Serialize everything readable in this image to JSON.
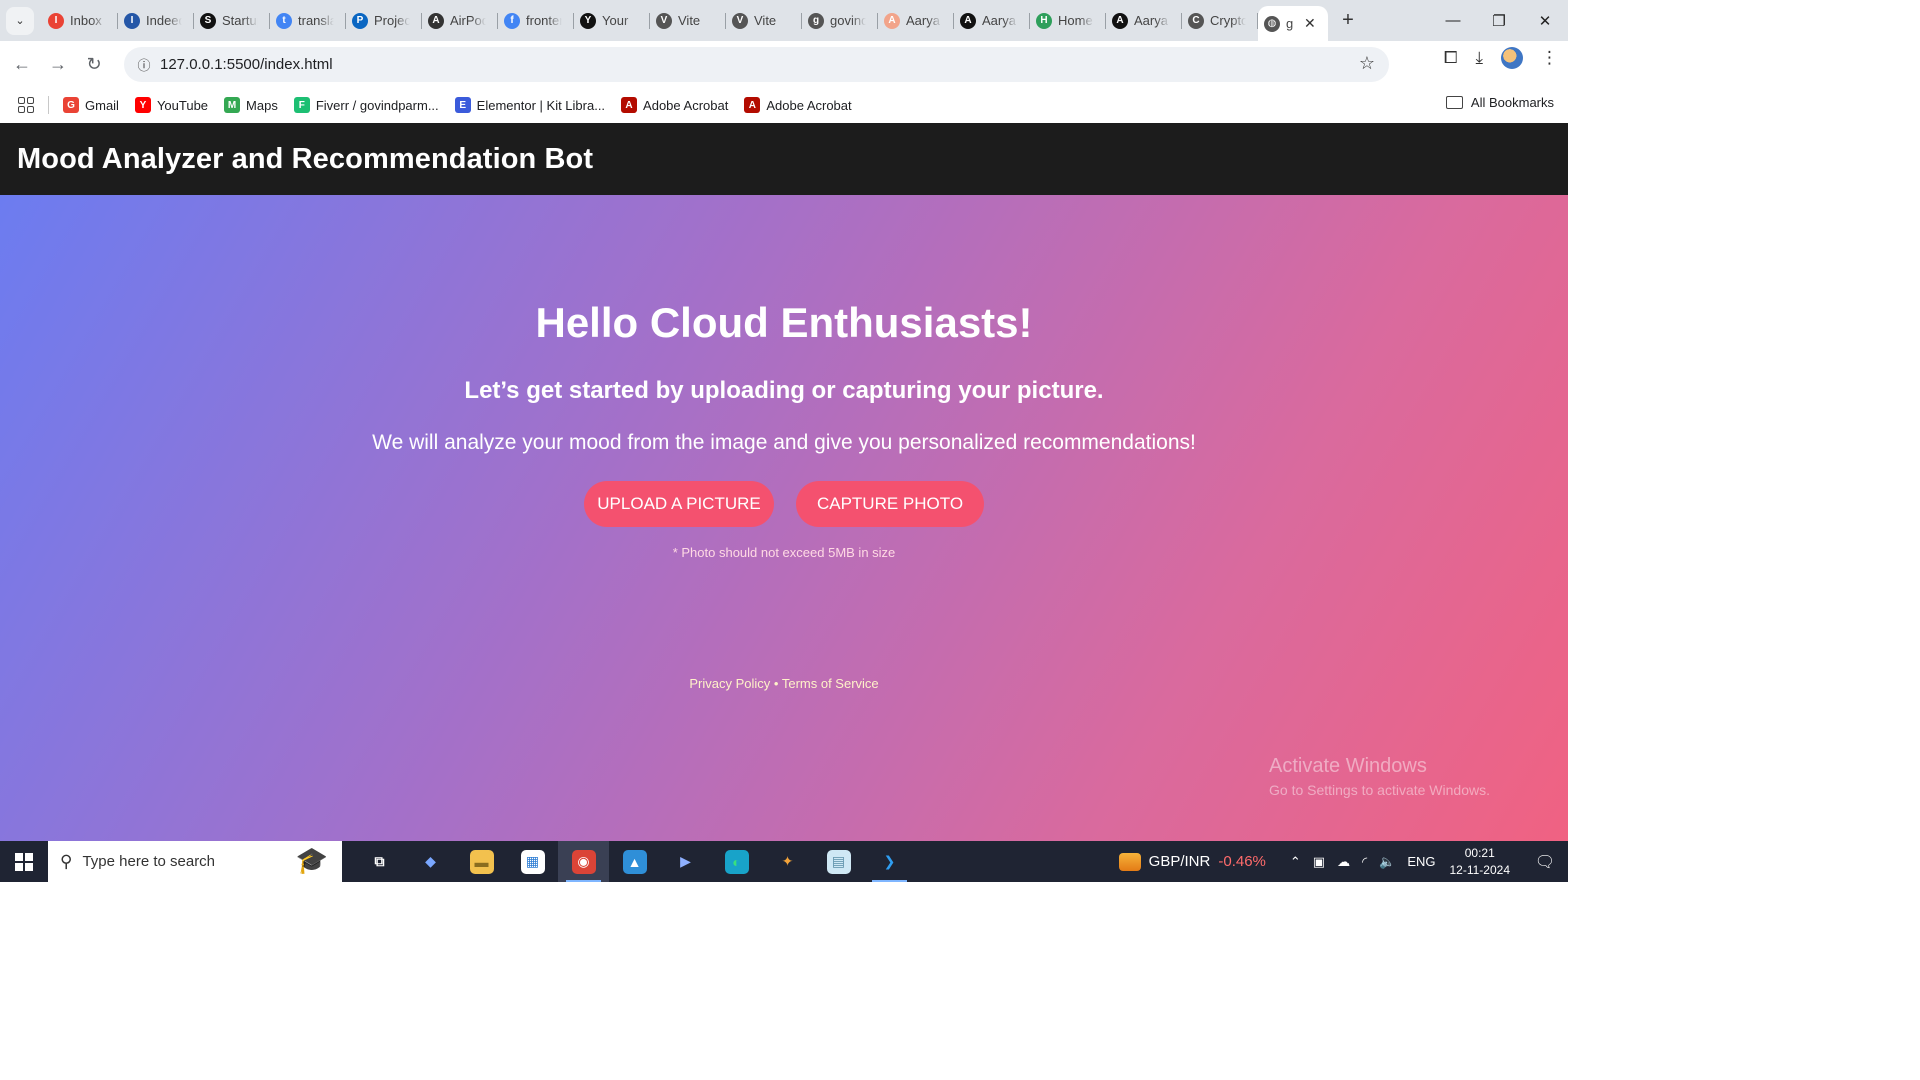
{
  "browser": {
    "tabs": [
      {
        "title": "Inbox",
        "icon": "gmail-icon",
        "color": "#ea4335"
      },
      {
        "title": "Indeed",
        "icon": "indeed-icon",
        "color": "#2557a7"
      },
      {
        "title": "Startup",
        "icon": "wix-icon",
        "color": "#111111"
      },
      {
        "title": "translate",
        "icon": "google-icon",
        "color": "#4285f4"
      },
      {
        "title": "Projects",
        "icon": "linkedin-icon",
        "color": "#0a66c2"
      },
      {
        "title": "AirPods",
        "icon": "openai-icon",
        "color": "#333333"
      },
      {
        "title": "frontend",
        "icon": "google-icon",
        "color": "#4285f4"
      },
      {
        "title": "Your",
        "icon": "github-icon",
        "color": "#111111"
      },
      {
        "title": "Vite",
        "icon": "globe-icon",
        "color": "#555555"
      },
      {
        "title": "Vite",
        "icon": "globe-icon",
        "color": "#555555"
      },
      {
        "title": "govind",
        "icon": "globe-icon",
        "color": "#555555"
      },
      {
        "title": "Aarya",
        "icon": "acrobat-icon",
        "color": "#f2a48a"
      },
      {
        "title": "Aarya",
        "icon": "github-icon",
        "color": "#111111"
      },
      {
        "title": "Home",
        "icon": "code-icon",
        "color": "#2e9f5b"
      },
      {
        "title": "Aarya",
        "icon": "github-icon",
        "color": "#111111"
      },
      {
        "title": "Crypto",
        "icon": "globe-icon",
        "color": "#555555"
      }
    ],
    "active_tab": {
      "title": "g",
      "icon": "globe-icon"
    },
    "url": "127.0.0.1:5500/index.html",
    "bookmarks": [
      {
        "label": "Gmail",
        "icon": "gmail-icon",
        "color": "#ea4335"
      },
      {
        "label": "YouTube",
        "icon": "youtube-icon",
        "color": "#ff0000"
      },
      {
        "label": "Maps",
        "icon": "maps-icon",
        "color": "#34a853"
      },
      {
        "label": "Fiverr / govindparm...",
        "icon": "fiverr-icon",
        "color": "#1dbf73"
      },
      {
        "label": "Elementor | Kit Libra...",
        "icon": "elementor-icon",
        "color": "#3b5bdb"
      },
      {
        "label": "Adobe Acrobat",
        "icon": "acrobat-icon",
        "color": "#b30b00"
      },
      {
        "label": "Adobe Acrobat",
        "icon": "acrobat-icon",
        "color": "#b30b00"
      }
    ],
    "all_bookmarks": "All Bookmarks"
  },
  "page": {
    "header_title": "Mood Analyzer and Recommendation Bot",
    "heading": "Hello Cloud Enthusiasts!",
    "subheading": "Let’s get started by uploading or capturing your picture.",
    "lead": "We will analyze your mood from the image and give you personalized recommendations!",
    "upload_button": "UPLOAD A PICTURE",
    "capture_button": "CAPTURE PHOTO",
    "size_note": "* Photo should not exceed 5MB in size",
    "privacy_link": "Privacy Policy",
    "separator": "•",
    "terms_link": "Terms of Service",
    "colors": {
      "header_bg": "#1c1c1c",
      "button": "#f4516f",
      "gradient_start": "#6c7cf0",
      "gradient_end": "#f06282"
    }
  },
  "watermark": {
    "line1": "Activate Windows",
    "line2": "Go to Settings to activate Windows."
  },
  "taskbar": {
    "search_placeholder": "Type here to search",
    "apps": [
      {
        "name": "task-view-icon",
        "glyph": "⧉",
        "bg": "transparent",
        "fg": "#ffffff"
      },
      {
        "name": "copilot-icon",
        "glyph": "◆",
        "bg": "transparent",
        "fg": "#7aa7ff"
      },
      {
        "name": "file-explorer-icon",
        "glyph": "▬",
        "bg": "#f2c14e",
        "fg": "#8a6d1f"
      },
      {
        "name": "microsoft-store-icon",
        "glyph": "▦",
        "bg": "#ffffff",
        "fg": "#2b7cd3"
      },
      {
        "name": "chrome-icon",
        "glyph": "◉",
        "bg": "#db4437",
        "fg": "#ffffff"
      },
      {
        "name": "photos-icon",
        "glyph": "▲",
        "bg": "#2f8fd8",
        "fg": "#ffffff"
      },
      {
        "name": "clipchamp-icon",
        "glyph": "▶",
        "bg": "transparent",
        "fg": "#8fb0ff"
      },
      {
        "name": "edge-icon",
        "glyph": "◐",
        "bg": "#18a3c9",
        "fg": "#39e07e"
      },
      {
        "name": "git-icon",
        "glyph": "✦",
        "bg": "transparent",
        "fg": "#f2a33a"
      },
      {
        "name": "notepad-icon",
        "glyph": "▤",
        "bg": "#cfe8f5",
        "fg": "#5b8fa8"
      },
      {
        "name": "vscode-icon",
        "glyph": "❯",
        "bg": "transparent",
        "fg": "#2f9ef2"
      }
    ],
    "ticker_pair": "GBP/INR",
    "ticker_change": "-0.46%",
    "language": "ENG",
    "time": "00:21",
    "date": "12-11-2024"
  }
}
